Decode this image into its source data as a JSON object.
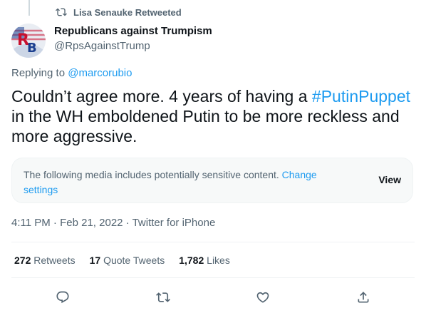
{
  "retweet_context": {
    "text": "Lisa Senauke Retweeted",
    "icon": "retweet-icon"
  },
  "author": {
    "display_name": "Republicans against Trumpism",
    "handle": "@RpsAgainstTrump",
    "avatar_letters": "RB",
    "avatar_colors": {
      "red": "#c8102e",
      "blue": "#1b3f8f"
    }
  },
  "reply": {
    "prefix": "Replying to ",
    "handle": "@marcorubio"
  },
  "tweet": {
    "text_before": "Couldn’t agree more. 4 years of having a ",
    "hashtag": "#PutinPuppet",
    "text_after": " in the WH emboldened Putin to be more reckless and more aggressive."
  },
  "sensitive": {
    "message": "The following media includes potentially sensitive content. ",
    "link": "Change settings",
    "view_label": "View"
  },
  "meta": {
    "time": "4:11 PM",
    "date": "Feb 21, 2022",
    "source": "Twitter for iPhone",
    "sep": " · "
  },
  "stats": {
    "retweets": {
      "count": "272",
      "label": "Retweets"
    },
    "quote_tweets": {
      "count": "17",
      "label": "Quote Tweets"
    },
    "likes": {
      "count": "1,782",
      "label": "Likes"
    }
  },
  "actions": [
    "reply-icon",
    "retweet-icon",
    "like-icon",
    "share-icon"
  ],
  "colors": {
    "accent": "#1d9bf0",
    "text": "#0f1419",
    "secondary": "#536471"
  }
}
